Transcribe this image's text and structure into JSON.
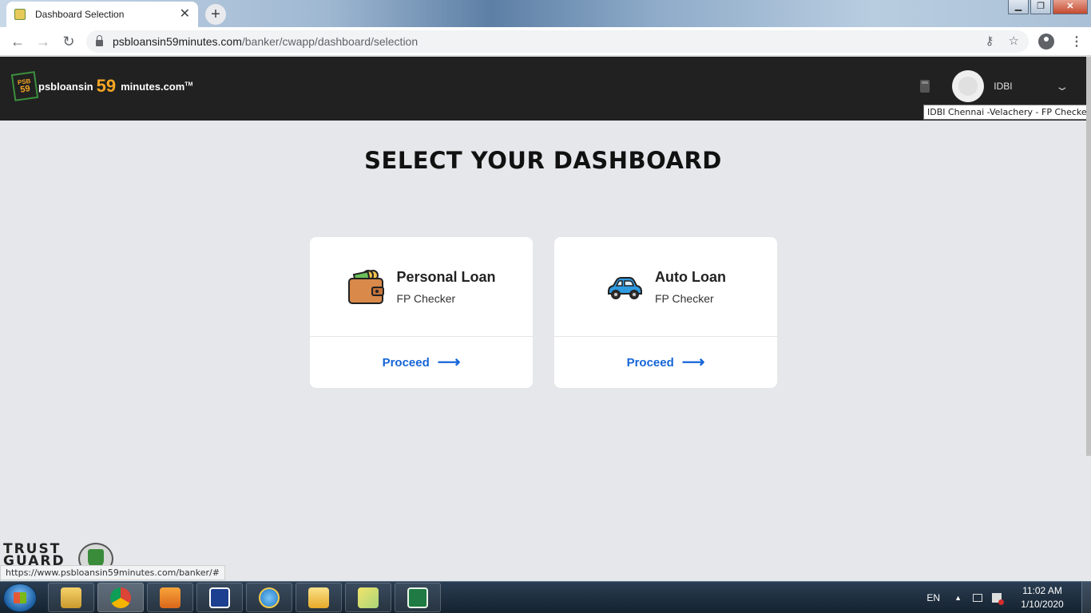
{
  "browser": {
    "tab_title": "Dashboard Selection",
    "tab_close": "✕",
    "new_tab": "+",
    "url_host": "psbloansin59minutes.com",
    "url_path": "/banker/cwapp/dashboard/selection",
    "window_controls": {
      "minimize": "▁",
      "maximize": "❐",
      "close": "✕"
    }
  },
  "header": {
    "logo_badge_top": "PSB",
    "logo_badge_num": "59",
    "logo_text_left": "psbloansin",
    "logo_num": "59",
    "logo_text_right": "minutes.com",
    "logo_tm": "TM",
    "bank_name": "IDBI",
    "user_tooltip": "IDBI Chennai -Velachery - FP Checker"
  },
  "main": {
    "title": "SELECT YOUR DASHBOARD",
    "cards": [
      {
        "name": "Personal Loan",
        "role": "FP Checker",
        "action": "Proceed",
        "icon": "wallet-icon"
      },
      {
        "name": "Auto Loan",
        "role": "FP Checker",
        "action": "Proceed",
        "icon": "car-icon"
      }
    ]
  },
  "footer": {
    "trust_badge": "TRUST GUARD",
    "status_url": "https://www.psbloansin59minutes.com/banker/#"
  },
  "taskbar": {
    "items": [
      "explorer-icon",
      "chrome-icon",
      "media-player-icon",
      "iw-icon",
      "ie-icon",
      "outlook-icon",
      "sticky-notes-icon",
      "excel-icon"
    ],
    "language": "EN",
    "time": "11:02 AM",
    "date": "1/10/2020"
  },
  "colors": {
    "accent": "#1565d8",
    "header_bg": "#212121",
    "page_bg": "#e5e7ea",
    "logo_orange": "#f5a623"
  }
}
